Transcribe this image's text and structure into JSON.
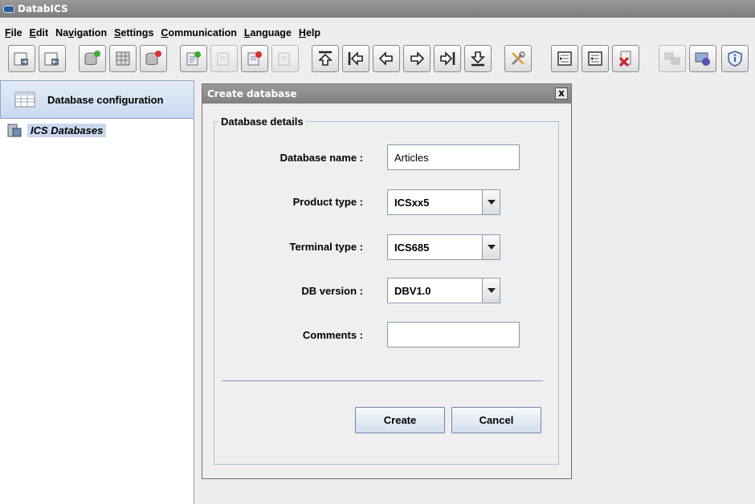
{
  "window": {
    "title": "DatabICS"
  },
  "menu": [
    {
      "pre": "",
      "u": "F",
      "post": "ile"
    },
    {
      "pre": "",
      "u": "E",
      "post": "dit"
    },
    {
      "pre": "Na",
      "u": "v",
      "post": "igation"
    },
    {
      "pre": "",
      "u": "S",
      "post": "ettings"
    },
    {
      "pre": "",
      "u": "C",
      "post": "ommunication"
    },
    {
      "pre": "",
      "u": "L",
      "post": "anguage"
    },
    {
      "pre": "",
      "u": "H",
      "post": "elp"
    }
  ],
  "toolbar": {
    "icons": [
      "window-in-icon",
      "window-out-icon",
      "database-add-icon",
      "database-table-icon",
      "database-delete-icon",
      "record-add-icon",
      "record-edit-icon",
      "record-delete-icon",
      "record-copy-icon",
      "first-icon",
      "previous-page-icon",
      "previous-icon",
      "next-icon",
      "next-page-icon",
      "last-icon",
      "tools-icon",
      "import-icon",
      "export-icon",
      "file-delete-icon",
      "transfer-icon",
      "monitor-icon",
      "info-shield-icon"
    ]
  },
  "sidebar": {
    "db_config_label": "Database configuration",
    "tree_root_label": "ICS Databases"
  },
  "dialog": {
    "title": "Create database",
    "close_label": "x",
    "group_title": "Database details",
    "fields": {
      "db_name_label": "Database name :",
      "db_name_value": "Articles",
      "product_type_label": "Product type :",
      "product_type_value": "ICSxx5",
      "terminal_type_label": "Terminal type :",
      "terminal_type_value": "ICS685",
      "db_version_label": "DB version :",
      "db_version_value": "DBV1.0",
      "comments_label": "Comments :",
      "comments_value": ""
    },
    "create_label": "Create",
    "cancel_label": "Cancel"
  }
}
